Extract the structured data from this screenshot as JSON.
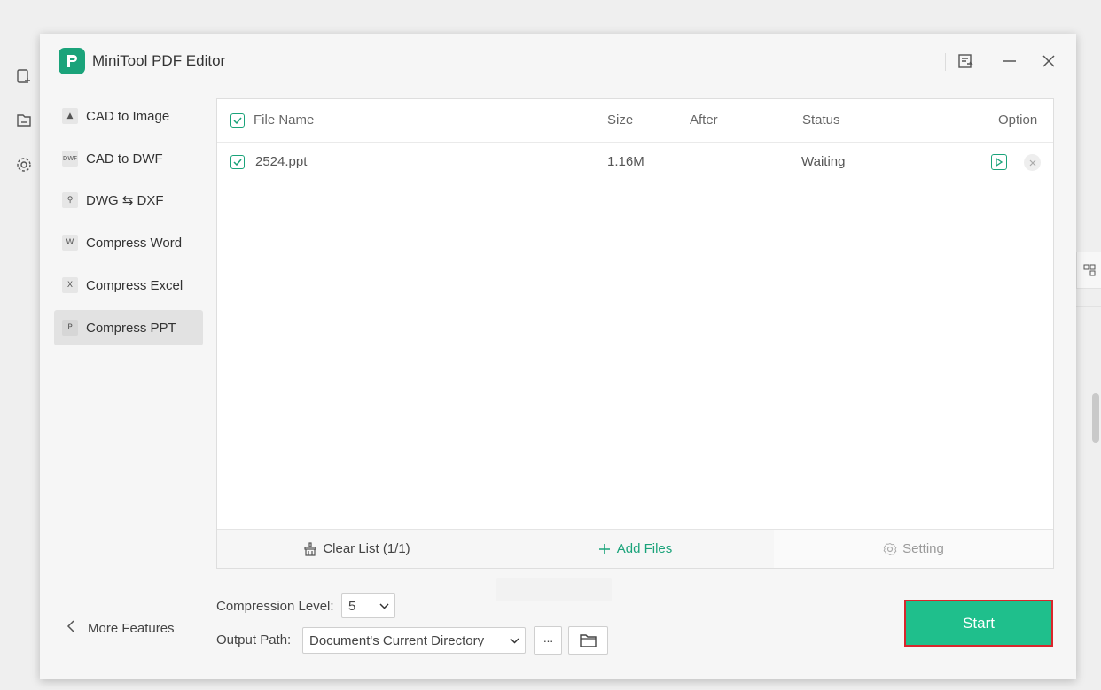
{
  "app": {
    "title": "MiniTool PDF Editor"
  },
  "sidebar": {
    "items": [
      {
        "label": "CAD to Image",
        "icon": "image-icon",
        "glyph": "▲"
      },
      {
        "label": "CAD to DWF",
        "icon": "dwf-icon",
        "glyph": "DWF"
      },
      {
        "label": "DWG ⇆ DXF",
        "icon": "dwg-dxf-icon",
        "glyph": "⚲"
      },
      {
        "label": "Compress Word",
        "icon": "compress-word-icon",
        "glyph": "W"
      },
      {
        "label": "Compress Excel",
        "icon": "compress-excel-icon",
        "glyph": "X"
      },
      {
        "label": "Compress PPT",
        "icon": "compress-ppt-icon",
        "glyph": "P"
      }
    ],
    "active_index": 5,
    "more_features": "More Features"
  },
  "table": {
    "columns": [
      "File Name",
      "Size",
      "After",
      "Status",
      "Option"
    ],
    "rows": [
      {
        "name": "2524.ppt",
        "size": "1.16M",
        "after": "",
        "status": "Waiting"
      }
    ]
  },
  "footer": {
    "clear_list": "Clear List (1/1)",
    "add_files": "Add Files",
    "setting": "Setting"
  },
  "controls": {
    "compression_label": "Compression Level:",
    "compression_value": "5",
    "output_label": "Output Path:",
    "output_value": "Document's Current Directory",
    "browse_label": "···",
    "start_label": "Start"
  },
  "colors": {
    "accent": "#1fbf8c",
    "brand": "#1aa37a",
    "highlight_border": "#d9262c"
  }
}
